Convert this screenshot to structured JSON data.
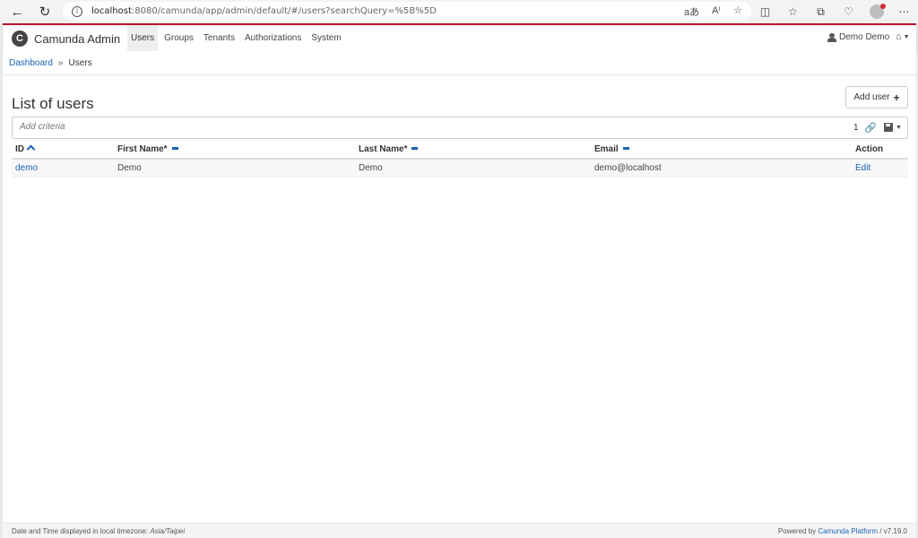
{
  "browser": {
    "url_host": "localhost",
    "url_path": ":8080/camunda/app/admin/default/#/users?searchQuery=%5B%5D"
  },
  "topnav": {
    "brand": "Camunda Admin",
    "logo_glyph": "C",
    "items": [
      {
        "label": "Users",
        "active": true
      },
      {
        "label": "Groups",
        "active": false
      },
      {
        "label": "Tenants",
        "active": false
      },
      {
        "label": "Authorizations",
        "active": false
      },
      {
        "label": "System",
        "active": false
      }
    ],
    "user": "Demo Demo"
  },
  "breadcrumb": {
    "root": "Dashboard",
    "separator": "»",
    "current": "Users"
  },
  "page": {
    "title": "List of users",
    "add_button": "Add user",
    "add_glyph": "+"
  },
  "search": {
    "placeholder": "Add criteria",
    "count": "1"
  },
  "table": {
    "headers": [
      "ID",
      "First Name*",
      "Last Name*",
      "Email",
      "Action"
    ],
    "rows": [
      {
        "id": "demo",
        "first": "Demo",
        "last": "Demo",
        "email": "demo@localhost",
        "action": "Edit"
      }
    ]
  },
  "footer": {
    "left_text": "Date and Time displayed in local timezone: ",
    "timezone": "Asia/Taipei",
    "powered_by": "Powered by ",
    "platform": "Camunda Platform",
    "version": " / v7.19.0"
  },
  "icons": [
    "back-icon",
    "reload-icon",
    "info-icon",
    "home-icon",
    "user-icon",
    "link-icon",
    "save-icon"
  ],
  "colors": {
    "accent": "#b5152b",
    "link": "#1a62b3"
  }
}
